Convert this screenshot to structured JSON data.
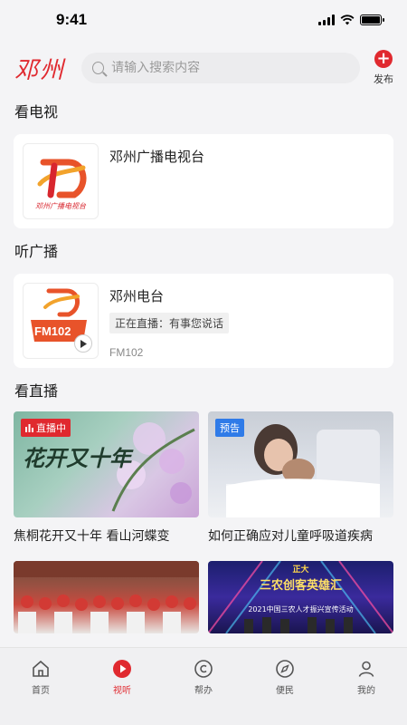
{
  "status": {
    "time": "9:41"
  },
  "header": {
    "logo": "邓州",
    "search_placeholder": "请输入搜索内容",
    "publish_label": "发布"
  },
  "sections": {
    "tv": "看电视",
    "radio": "听广播",
    "live": "看直播"
  },
  "tv_card": {
    "name": "邓州广播电视台",
    "logo_text": "邓州广播电视台"
  },
  "radio_card": {
    "name": "邓州电台",
    "live_text": "正在直播：有事您说话",
    "freq": "FM102",
    "logo_text": "FM102"
  },
  "live_tiles": [
    {
      "badge": "直播中",
      "caption": "焦桐花开又十年 看山河蝶变",
      "art_title": "花开又十年"
    },
    {
      "badge": "预告",
      "caption": "如何正确应对儿童呼吸道疾病"
    },
    {
      "badge": "",
      "caption": ""
    },
    {
      "badge": "",
      "caption": "",
      "art_title": "三农创客英雄汇",
      "art_sub": "2021中国三农人才振兴宣传活动",
      "art_top": "正大"
    }
  ],
  "tabbar": [
    {
      "label": "首页",
      "icon": "home-icon",
      "active": false
    },
    {
      "label": "视听",
      "icon": "play-icon",
      "active": true
    },
    {
      "label": "帮办",
      "icon": "help-icon",
      "active": false
    },
    {
      "label": "便民",
      "icon": "compass-icon",
      "active": false
    },
    {
      "label": "我的",
      "icon": "user-icon",
      "active": false
    }
  ],
  "colors": {
    "accent": "#e0292f",
    "preview": "#2f7be8"
  }
}
